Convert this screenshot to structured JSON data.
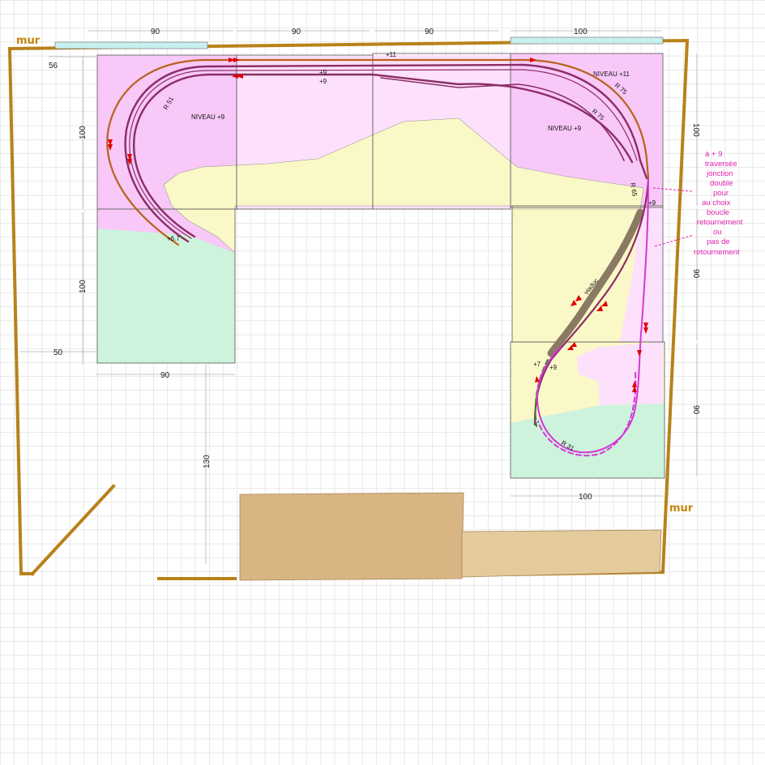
{
  "dimensions": {
    "top_1": "90",
    "top_2": "90",
    "top_3": "90",
    "top_4": "100",
    "left_56": "56",
    "left_100_a": "100",
    "left_100_b": "100",
    "left_50": "50",
    "bottom_left_90": "90",
    "center_130": "130",
    "right_100": "100",
    "right_90_a": "90",
    "right_90_b": "90",
    "bottom_right_100": "100"
  },
  "walls": {
    "top_left": "mur",
    "bottom_right": "mur"
  },
  "levels": {
    "left_level": "NIVEAU +9",
    "right_level_11": "NIVEAU +11",
    "right_level_9": "NIVEAU +9"
  },
  "radii": {
    "r51": "R 51",
    "r75_a": "R 75",
    "r75_b": "R 75",
    "r65": "R 65",
    "r31": "R 31"
  },
  "heights": {
    "plus11_top": "+11",
    "plus9_a": "+9",
    "plus9_b": "+9",
    "plus67": "+6.7",
    "plus9_right": "+9",
    "plus7": "+7",
    "plus9_low": "+9"
  },
  "viaduct_label": "viaduc",
  "note_lines": [
    "à + 9",
    "traversée",
    "jonction",
    "double",
    "pour",
    "au choix",
    "boucle",
    "retournement",
    "ou",
    "pas de",
    "retournement"
  ],
  "colors": {
    "wall": "#b8821a",
    "pink": "#f8c8f8",
    "light_pink": "#fde0fb",
    "yellow": "#fbf8c8",
    "mint": "#cdf3dd",
    "track_purple": "#8b2e64",
    "track_brown": "#b8621a",
    "loop_magenta": "#d637d6",
    "arrow_red": "#e00000",
    "furniture": "#d9b583"
  }
}
